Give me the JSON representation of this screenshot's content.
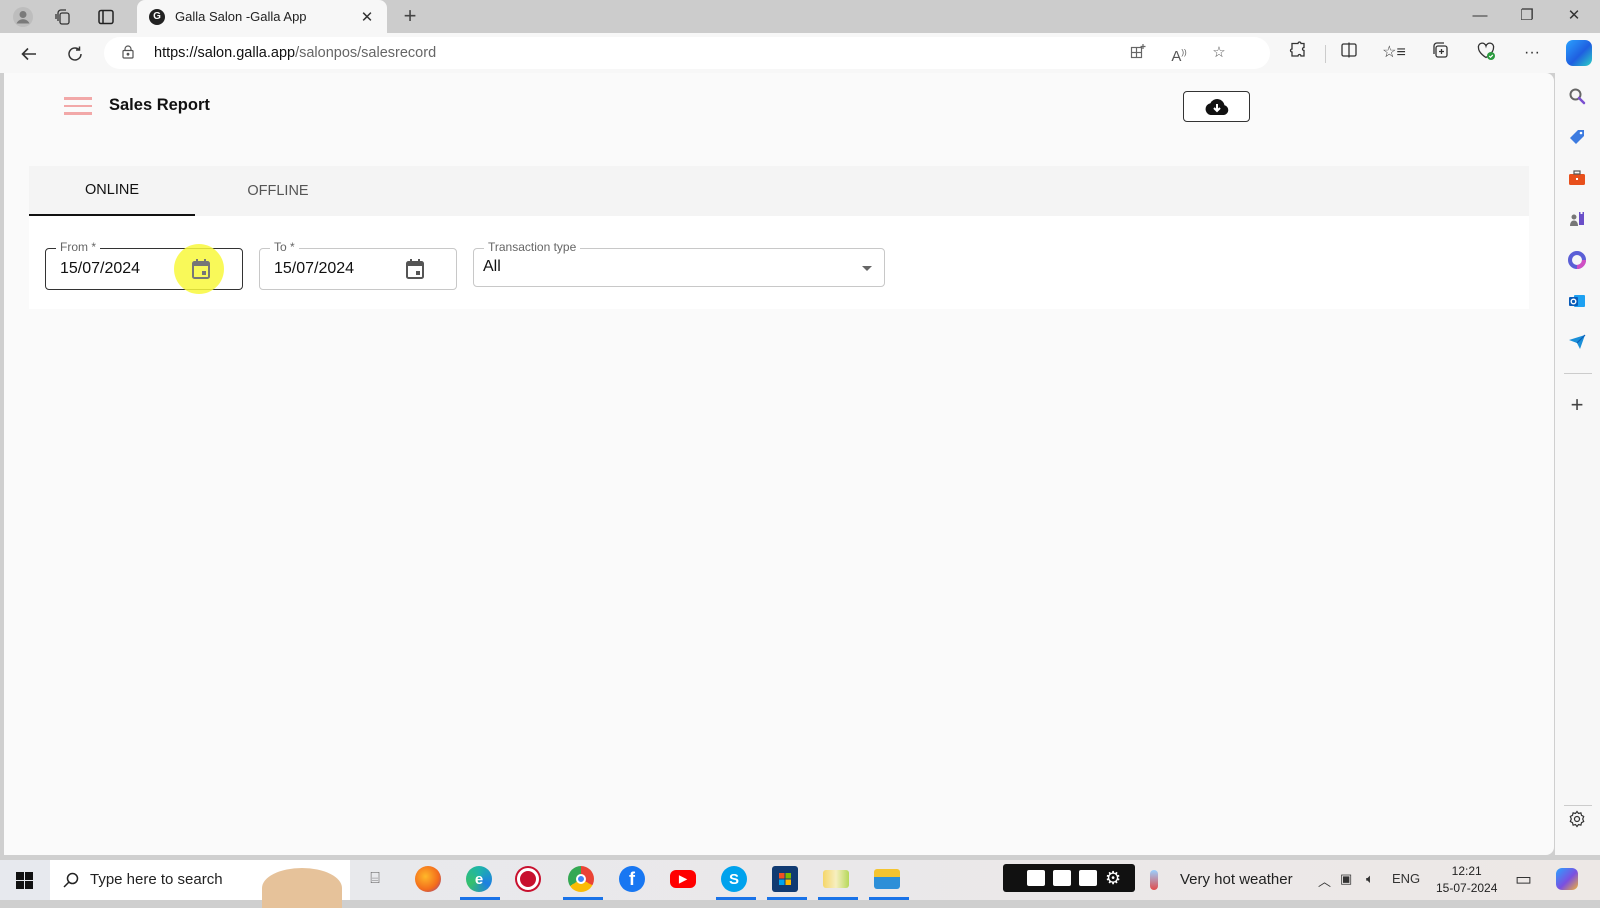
{
  "browser": {
    "tab_title": "Galla Salon -Galla App",
    "url_host": "https://salon.galla.app",
    "url_path": "/salonpos/salesrecord",
    "icons": {
      "profile": "profile-icon",
      "workspaces": "workspaces-icon",
      "tab_actions": "tab-actions-icon",
      "close_tab": "close-icon",
      "new_tab": "plus-icon",
      "minimize": "minimize-icon",
      "restore": "restore-icon",
      "close_window": "close-icon",
      "back": "back-arrow-icon",
      "refresh": "refresh-icon",
      "lock": "lock-icon",
      "app_available": "app-available-icon",
      "read_aloud": "read-aloud-icon",
      "favorite": "star-icon",
      "extensions": "puzzle-icon",
      "split_screen": "split-screen-icon",
      "favorites": "favorites-icon",
      "collections": "collections-icon",
      "browser_essentials": "heart-pulse-icon",
      "more": "more-icon",
      "copilot": "copilot-icon"
    }
  },
  "header": {
    "title": "Sales Report",
    "download_icon": "cloud-download-icon"
  },
  "tabs": [
    {
      "label": "ONLINE",
      "active": true
    },
    {
      "label": "OFFLINE",
      "active": false
    }
  ],
  "filters": {
    "from": {
      "label": "From *",
      "value": "15/07/2024"
    },
    "to": {
      "label": "To *",
      "value": "15/07/2024"
    },
    "transaction_type": {
      "label": "Transaction type",
      "value": "All"
    }
  },
  "sidebar": {
    "items": [
      "search-icon",
      "shopping-tag-icon",
      "toolbox-icon",
      "games-icon",
      "microsoft365-icon",
      "outlook-icon",
      "send-icon",
      "plus-icon",
      "settings-icon"
    ]
  },
  "taskbar": {
    "search_placeholder": "Type here to search",
    "apps": [
      "task-view-icon",
      "firefox-icon",
      "edge-icon",
      "recorder-icon",
      "chrome-icon",
      "facebook-icon",
      "youtube-icon",
      "skype-icon",
      "store-icon",
      "maps-icon",
      "file-explorer-icon"
    ],
    "weather": "Very hot weather",
    "language": "ENG",
    "time": "12:21",
    "date": "15-07-2024",
    "colors": {
      "accent": "#1a73e8"
    }
  }
}
